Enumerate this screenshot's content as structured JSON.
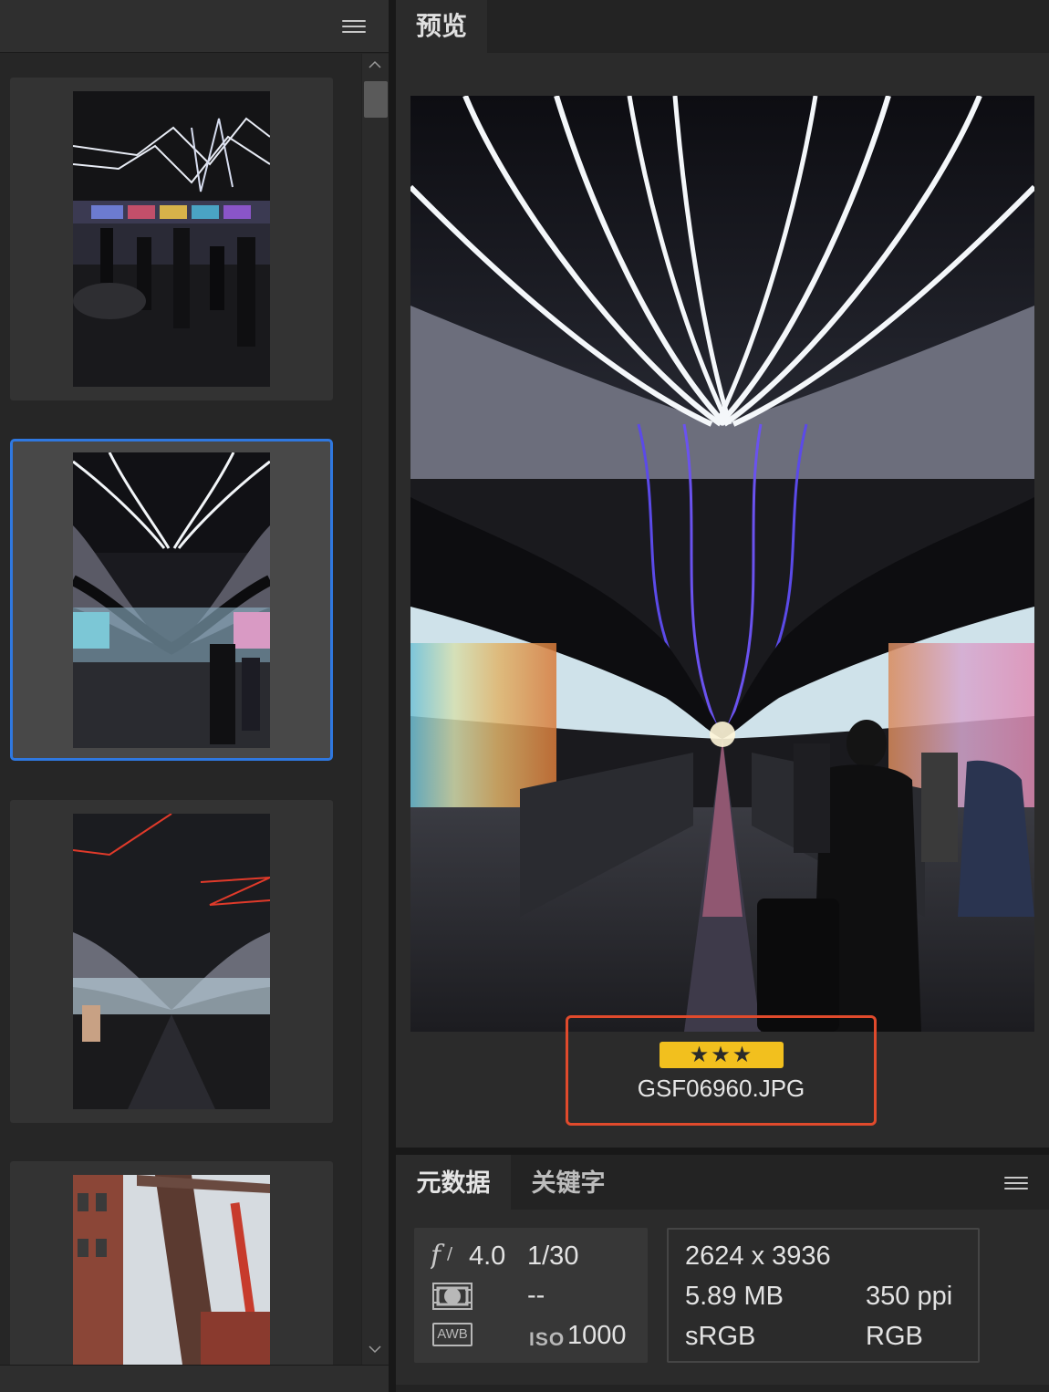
{
  "preview_panel": {
    "tab_label": "预览",
    "file": {
      "rating_stars": 3,
      "rating_text": "★★★",
      "filename": "GSF06960.JPG"
    }
  },
  "metadata_panel": {
    "tabs": [
      {
        "label": "元数据",
        "active": true
      },
      {
        "label": "关键字",
        "active": false
      }
    ],
    "camera": {
      "aperture": "4.0",
      "shutter": "1/30",
      "metering": "--",
      "white_balance_label": "AWB",
      "iso_label": "ISO",
      "iso": "1000"
    },
    "file_info": {
      "dimensions": "2624 x 3936",
      "size": "5.89 MB",
      "resolution": "350 ppi",
      "color_profile": "sRGB",
      "color_mode": "RGB"
    }
  },
  "thumbnails": [
    {
      "name": "light-tunnel-people",
      "selected": false
    },
    {
      "name": "light-tunnel-walkway",
      "selected": true
    },
    {
      "name": "red-lights-tunnel",
      "selected": false
    },
    {
      "name": "brick-industrial",
      "selected": false
    }
  ],
  "scrollbar": {
    "up_icon": "chevron-up-icon",
    "down_icon": "chevron-down-icon"
  },
  "colors": {
    "selection": "#2f78e0",
    "highlight": "#e04a2c",
    "rating_badge": "#f2c01e",
    "panel_bg": "#2b2b2b"
  }
}
